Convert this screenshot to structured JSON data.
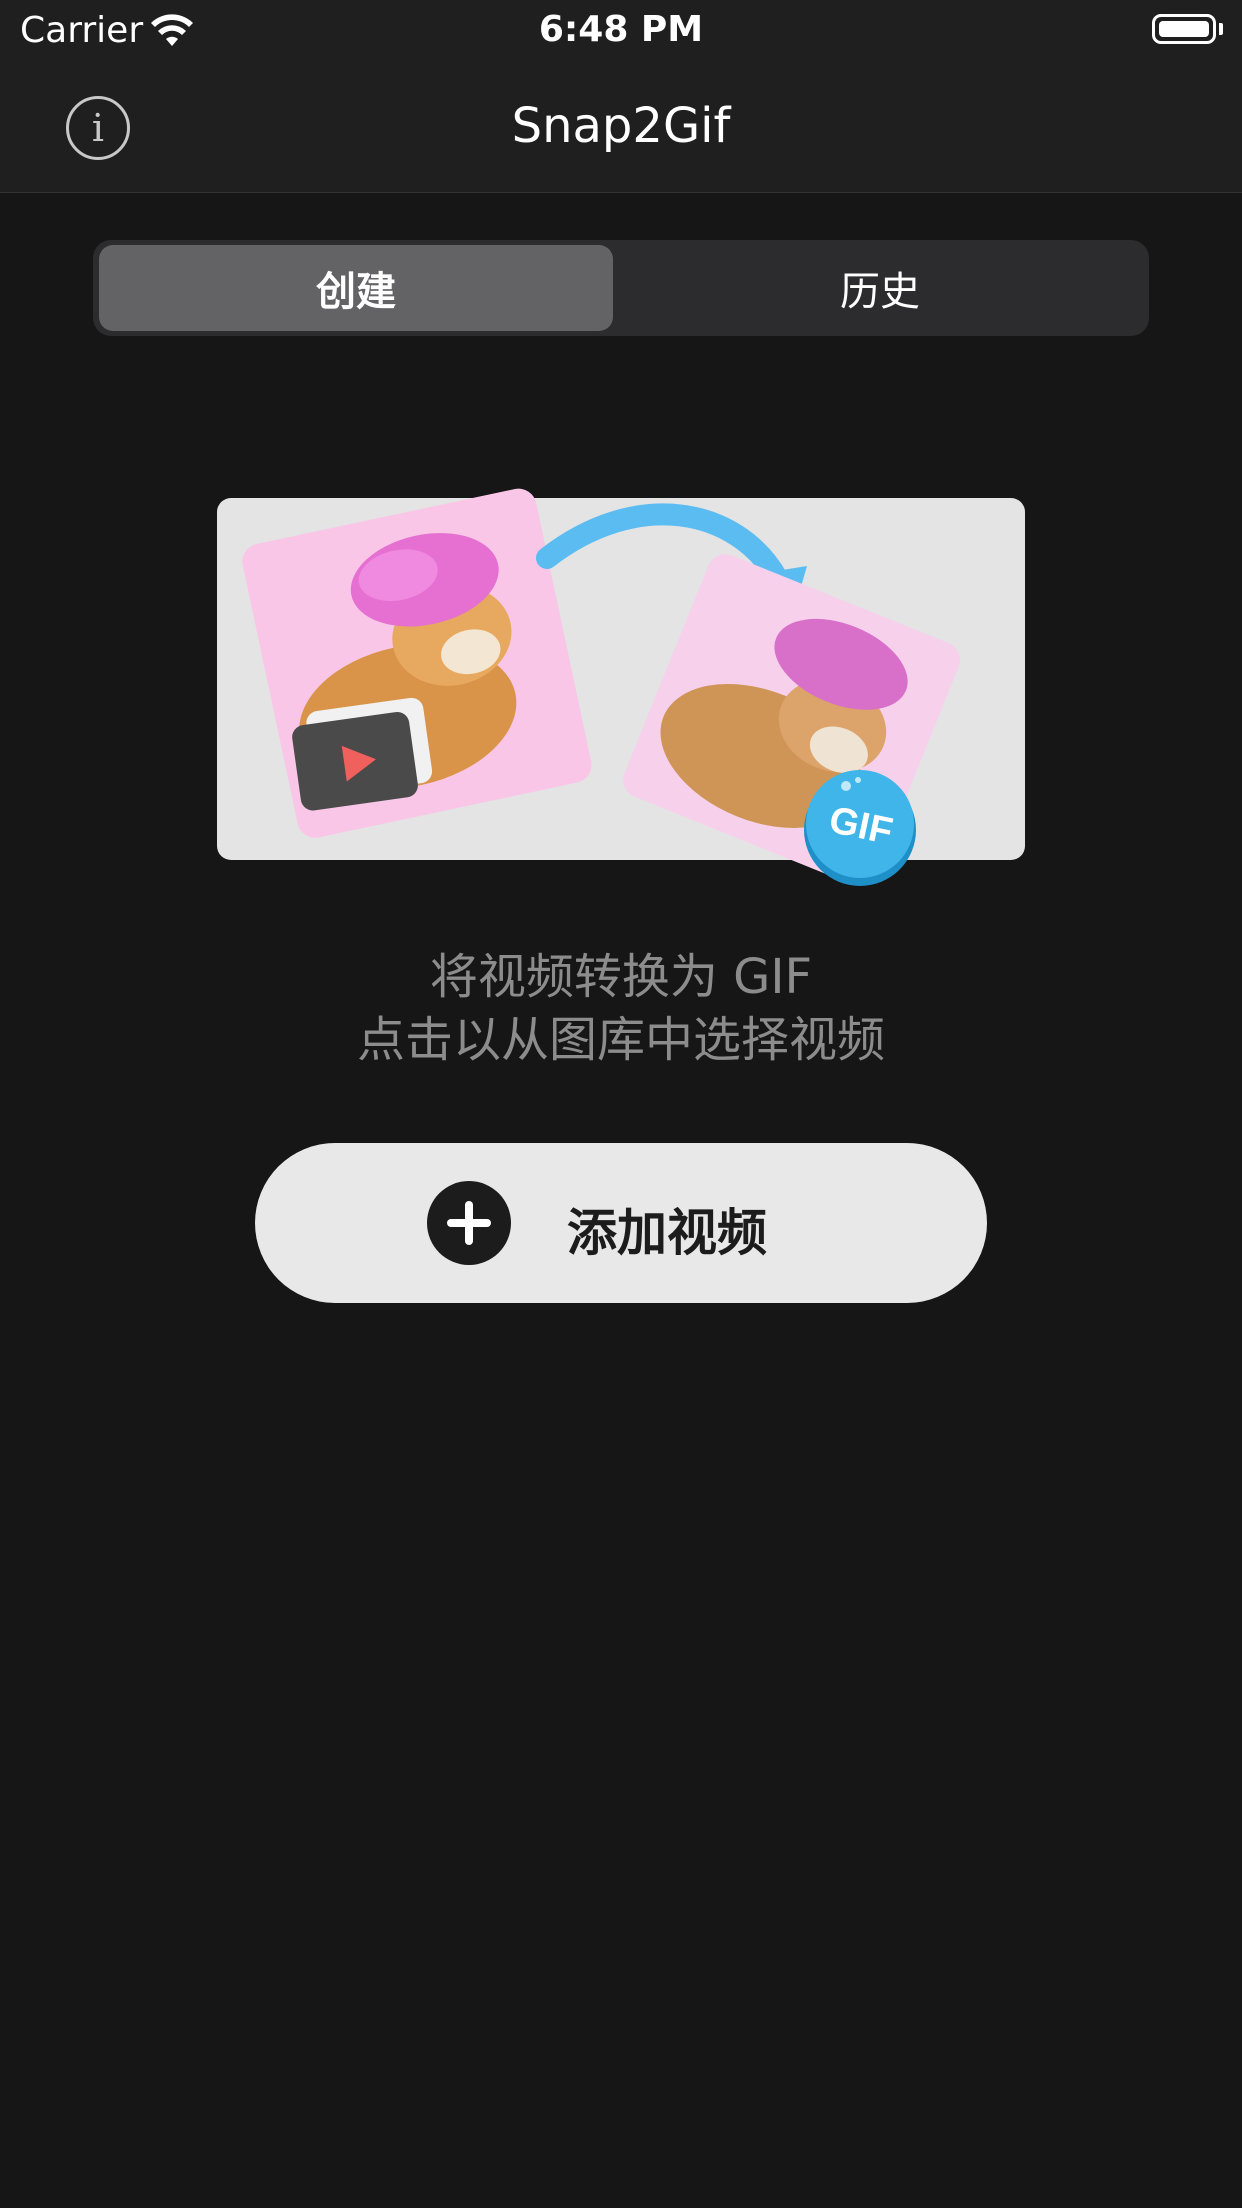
{
  "status_bar": {
    "carrier": "Carrier",
    "time": "6:48 PM",
    "wifi_icon": "wifi-icon",
    "battery_icon": "battery-full-icon"
  },
  "nav": {
    "title": "Snap2Gif",
    "info_icon": "info-icon"
  },
  "segments": {
    "create": "创建",
    "history": "历史",
    "selected": "create"
  },
  "illustration": {
    "badge_text": "GIF"
  },
  "description": {
    "line1": "将视频转换为 GIF",
    "line2": "点击以从图库中选择视频"
  },
  "add_button": {
    "label": "添加视频",
    "icon": "plus-icon"
  },
  "colors": {
    "background": "#161616",
    "bar": "#1f1f1f",
    "segment_bg": "#2c2c2e",
    "segment_selected": "#636366",
    "button_bg": "#e8e8e8",
    "arrow": "#5bbcf2",
    "gif_badge": "#3fb5ea"
  }
}
